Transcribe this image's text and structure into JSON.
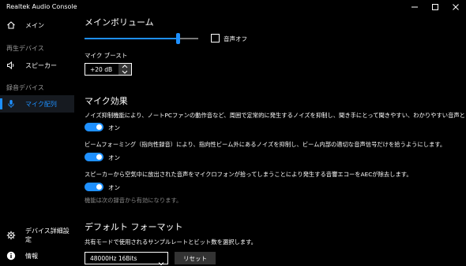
{
  "app": {
    "title": "Realtek Audio Console"
  },
  "sidebar": {
    "main_label": "メイン",
    "playback_header": "再生デバイス",
    "speaker_label": "スピーカー",
    "recording_header": "録音デバイス",
    "mic_array_label": "マイク配列",
    "device_settings_label": "デバイス詳細設定",
    "info_label": "情報"
  },
  "main_volume": {
    "title": "メインボリューム",
    "level": 0.82,
    "mute_label": "音声オフ",
    "mute_checked": false
  },
  "mic_boost": {
    "label": "マイク ブースト",
    "value": "+20 dB"
  },
  "mic_effects": {
    "title": "マイク効果",
    "noise_suppression": "ノイズ抑制機能により、ノートPCファンの動作音など、周囲で定常的に発生するノイズを抑制し、聞き手にとって聞きやすい、わかりやすい音声とします。",
    "beamforming": "ビームフォーミング（指向性録音）により、指向性ビーム外にあるノイズを抑制し、ビーム内部の適切な音声信号だけを拾うようにします。",
    "aec": "スピーカーから空気中に放出された音声をマイクロフォンが拾ってしまうことにより発生する音響エコーをAECが除去します。",
    "toggle_on_label": "オン",
    "restart_note": "機能は次の録音から有効になります。"
  },
  "default_format": {
    "title": "デフォルト フォーマット",
    "description": "共有モードで使用されるサンプルレートとビット数を選択します。",
    "selected": "48000Hz 16Bits",
    "reset_label": "リセット"
  },
  "colors": {
    "accent": "#1e90ff",
    "background": "#000000"
  }
}
